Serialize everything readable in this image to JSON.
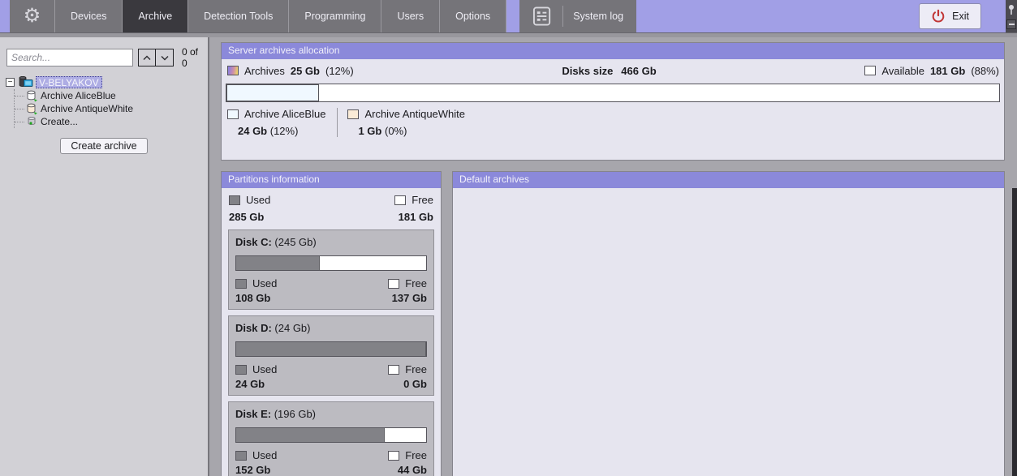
{
  "topbar": {
    "tabs": [
      {
        "label": "Devices",
        "active": false
      },
      {
        "label": "Archive",
        "active": true
      },
      {
        "label": "Detection Tools",
        "active": false
      },
      {
        "label": "Programming",
        "active": false
      },
      {
        "label": "Users",
        "active": false
      },
      {
        "label": "Options",
        "active": false
      }
    ],
    "system_log_label": "System log",
    "exit_label": "Exit"
  },
  "sidebar": {
    "search_placeholder": "Search...",
    "search_count": "0 of 0",
    "tree": {
      "root_label": "V-BELYAKOV",
      "children": [
        {
          "label": "Archive AliceBlue",
          "icon": "archive-cylinder-aliceblue"
        },
        {
          "label": "Archive AntiqueWhite",
          "icon": "archive-cylinder-antiquewhite"
        },
        {
          "label": "Create...",
          "icon": "create-archive-plus"
        }
      ]
    },
    "create_archive_button": "Create archive"
  },
  "allocation_panel": {
    "title": "Server archives allocation",
    "archives_label": "Archives",
    "archives_value": "25 Gb",
    "archives_percent": "(12%)",
    "disks_size_label": "Disks size",
    "disks_size_value": "466 Gb",
    "available_label": "Available",
    "available_value": "181 Gb",
    "available_percent": "(88%)",
    "bar_fill_percent": 12,
    "archives": [
      {
        "name": "Archive AliceBlue",
        "value": "24 Gb",
        "percent": "(12%)",
        "color": "#f0f8ff"
      },
      {
        "name": "Archive AntiqueWhite",
        "value": "1 Gb",
        "percent": "(0%)",
        "color": "#faebd7"
      }
    ]
  },
  "partitions_panel": {
    "title": "Partitions information",
    "used_label": "Used",
    "free_label": "Free",
    "total_used": "285 Gb",
    "total_free": "181 Gb",
    "disks": [
      {
        "name": "Disk C:",
        "size": "(245 Gb)",
        "used": "108 Gb",
        "free": "137 Gb",
        "used_percent": 44
      },
      {
        "name": "Disk D:",
        "size": "(24 Gb)",
        "used": "24 Gb",
        "free": "0 Gb",
        "used_percent": 100
      },
      {
        "name": "Disk E:",
        "size": "(196 Gb)",
        "used": "152 Gb",
        "free": "44 Gb",
        "used_percent": 78
      }
    ]
  },
  "default_archives_panel": {
    "title": "Default archives"
  },
  "colors": {
    "accent_lavender": "#a19fe6",
    "panel_header_purple": "#8b89da",
    "aliceblue": "#f0f8ff",
    "antiquewhite": "#faebd7",
    "used_gray": "#828287",
    "free_white": "#ffffff",
    "exit_red": "#c13535"
  }
}
